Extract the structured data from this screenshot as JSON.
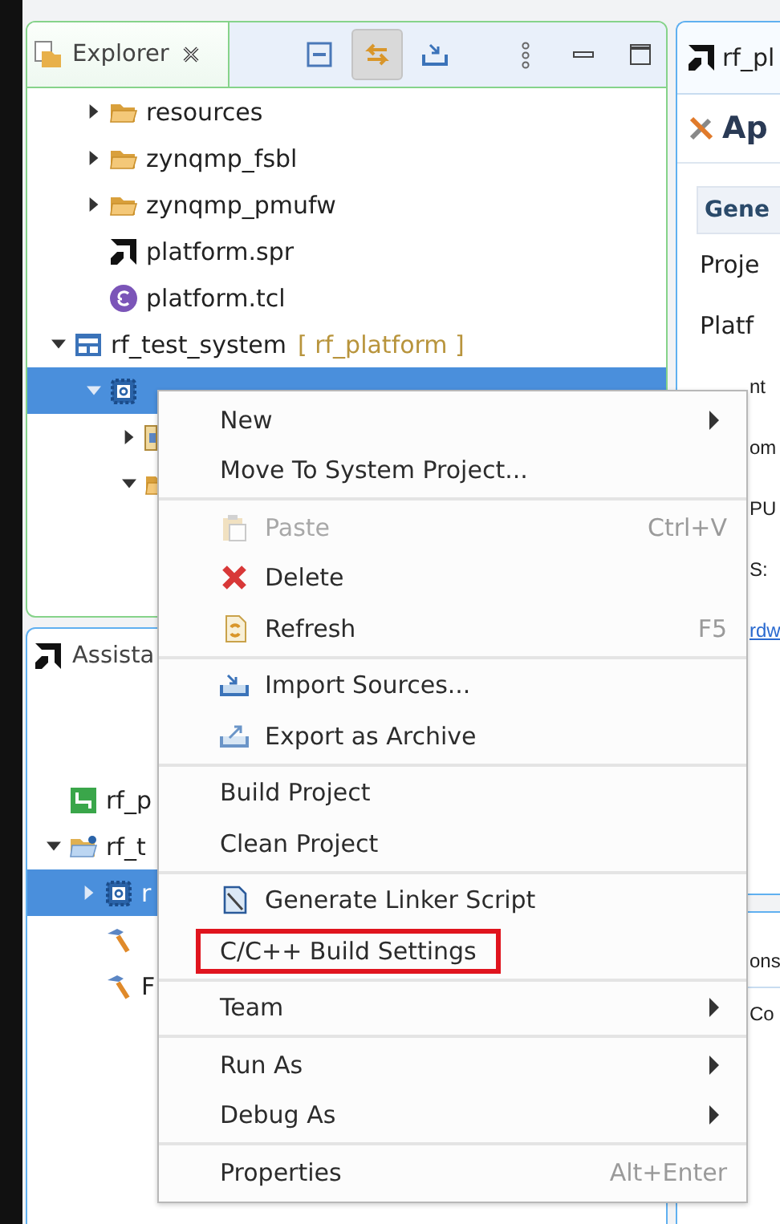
{
  "explorer": {
    "tab": {
      "label": "Explorer"
    },
    "toolbar": [
      {
        "kind": "collapse",
        "pressed": false
      },
      {
        "kind": "link",
        "pressed": true
      },
      {
        "kind": "import",
        "pressed": false
      },
      {
        "kind": "kebab",
        "pressed": false
      },
      {
        "kind": "minimize",
        "pressed": false
      },
      {
        "kind": "maximize",
        "pressed": false
      }
    ],
    "tree": [
      {
        "kind": "group",
        "children": [
          {
            "label": "resources",
            "kind": "folder",
            "expanded": false,
            "selected": false
          },
          {
            "label": "zynqmp_fsbl",
            "kind": "folder",
            "expanded": false,
            "selected": false
          },
          {
            "label": "zynqmp_pmufw",
            "kind": "folder",
            "expanded": false,
            "selected": false
          },
          {
            "label": "platform.spr",
            "kind": "amd",
            "selected": false
          },
          {
            "label": "platform.tcl",
            "kind": "tcl",
            "selected": false
          }
        ]
      },
      {
        "label": "rf_test_system",
        "decoration": "[ rf_platform ]",
        "kind": "system",
        "expanded": true,
        "selected": false,
        "children": [
          {
            "kind": "domain",
            "expanded": true,
            "selected": true,
            "children": [
              {
                "kind": "hw",
                "expanded": false,
                "selected": false
              },
              {
                "kind": "folder",
                "expanded": true,
                "selected": false
              }
            ]
          }
        ]
      }
    ]
  },
  "assistant": {
    "title": "Assista",
    "tree": [
      {
        "label": "rf_p",
        "kind": "platform",
        "selected": false
      },
      {
        "label": "rf_t",
        "kind": "app",
        "expanded": true,
        "selected": false,
        "children": [
          {
            "label": "r",
            "kind": "domain",
            "expanded": false,
            "selected": true
          },
          {
            "kind": "build",
            "selected": false
          },
          {
            "label": "F",
            "kind": "build",
            "selected": false
          }
        ]
      }
    ]
  },
  "editor": {
    "tab": "rf_pl",
    "heading": "Ap",
    "section_tab": "Gene",
    "rows": [
      {
        "text": "Proje",
        "kind": "label"
      },
      {
        "text": "Platf",
        "kind": "label"
      },
      {
        "text": "nt",
        "kind": "peek"
      },
      {
        "text": "om",
        "kind": "peek"
      },
      {
        "text": "PU",
        "kind": "peek"
      },
      {
        "text": "S:",
        "kind": "peek"
      },
      {
        "text": "rdw",
        "kind": "link"
      }
    ],
    "lower_rows": [
      {
        "text": "ons",
        "kind": "peek"
      },
      {
        "text": "Co",
        "kind": "peek"
      }
    ]
  },
  "context_menu": {
    "groups": [
      [
        {
          "label": "New",
          "submenu": true,
          "disabled": false,
          "highlighted": false
        },
        {
          "label": "Move To System Project...",
          "disabled": false,
          "highlighted": false
        }
      ],
      [
        {
          "label": "Paste",
          "kind": "paste",
          "shortcut": "Ctrl+V",
          "disabled": true,
          "highlighted": false
        },
        {
          "label": "Delete",
          "kind": "delete",
          "disabled": false,
          "highlighted": false
        },
        {
          "label": "Refresh",
          "kind": "refresh",
          "shortcut": "F5",
          "disabled": false,
          "highlighted": false
        }
      ],
      [
        {
          "label": "Import Sources...",
          "kind": "import",
          "disabled": false,
          "highlighted": false
        },
        {
          "label": "Export as Archive",
          "kind": "export",
          "disabled": false,
          "highlighted": false
        }
      ],
      [
        {
          "label": "Build Project",
          "disabled": false,
          "highlighted": false
        },
        {
          "label": "Clean Project",
          "disabled": false,
          "highlighted": false
        }
      ],
      [
        {
          "label": "Generate Linker Script",
          "kind": "linker",
          "disabled": false,
          "highlighted": false
        },
        {
          "label": "C/C++ Build Settings",
          "disabled": false,
          "highlighted": true
        }
      ],
      [
        {
          "label": "Team",
          "submenu": true,
          "disabled": false,
          "highlighted": false
        }
      ],
      [
        {
          "label": "Run As",
          "submenu": true,
          "disabled": false,
          "highlighted": false
        },
        {
          "label": "Debug As",
          "submenu": true,
          "disabled": false,
          "highlighted": false
        }
      ],
      [
        {
          "label": "Properties",
          "shortcut": "Alt+Enter",
          "disabled": false,
          "highlighted": false
        }
      ]
    ]
  }
}
